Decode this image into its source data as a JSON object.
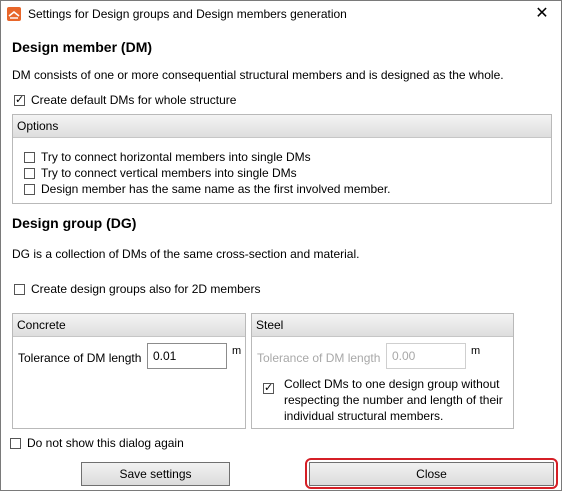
{
  "window": {
    "title": "Settings for Design groups and Design members generation",
    "close_glyph": "✕"
  },
  "dm": {
    "heading": "Design member (DM)",
    "description": "DM consists of one or more consequential structural members and is designed as the whole.",
    "create_default_label": "Create default DMs for whole structure",
    "create_default_checked": true,
    "options": {
      "header": "Options",
      "items": [
        {
          "label": "Try to connect horizontal members into single DMs",
          "checked": false
        },
        {
          "label": "Try to connect vertical members into single DMs",
          "checked": false
        },
        {
          "label": "Design member has the same name as the first involved member.",
          "checked": false
        }
      ]
    }
  },
  "dg": {
    "heading": "Design group (DG)",
    "description": "DG is a collection of DMs of the same cross-section and material.",
    "create_2d_label": "Create design groups also for 2D members",
    "create_2d_checked": false,
    "concrete": {
      "header": "Concrete",
      "tolerance_label": "Tolerance of DM length",
      "tolerance_value": "0.01",
      "unit": "m"
    },
    "steel": {
      "header": "Steel",
      "tolerance_label": "Tolerance of DM length",
      "tolerance_value": "0.00",
      "unit": "m",
      "collect_label_line1": "Collect DMs to one design group without",
      "collect_label_line2": "respecting the number and length of their",
      "collect_label_line3": "individual structural members.",
      "collect_checked": true
    }
  },
  "footer": {
    "dont_show_label": "Do not show this dialog again",
    "dont_show_checked": false,
    "save_label": "Save settings",
    "close_label": "Close"
  },
  "colors": {
    "highlight": "#d51f26",
    "app_icon": "#e8662a"
  },
  "icons": {
    "app": "app-logo-icon",
    "close": "close-icon"
  }
}
